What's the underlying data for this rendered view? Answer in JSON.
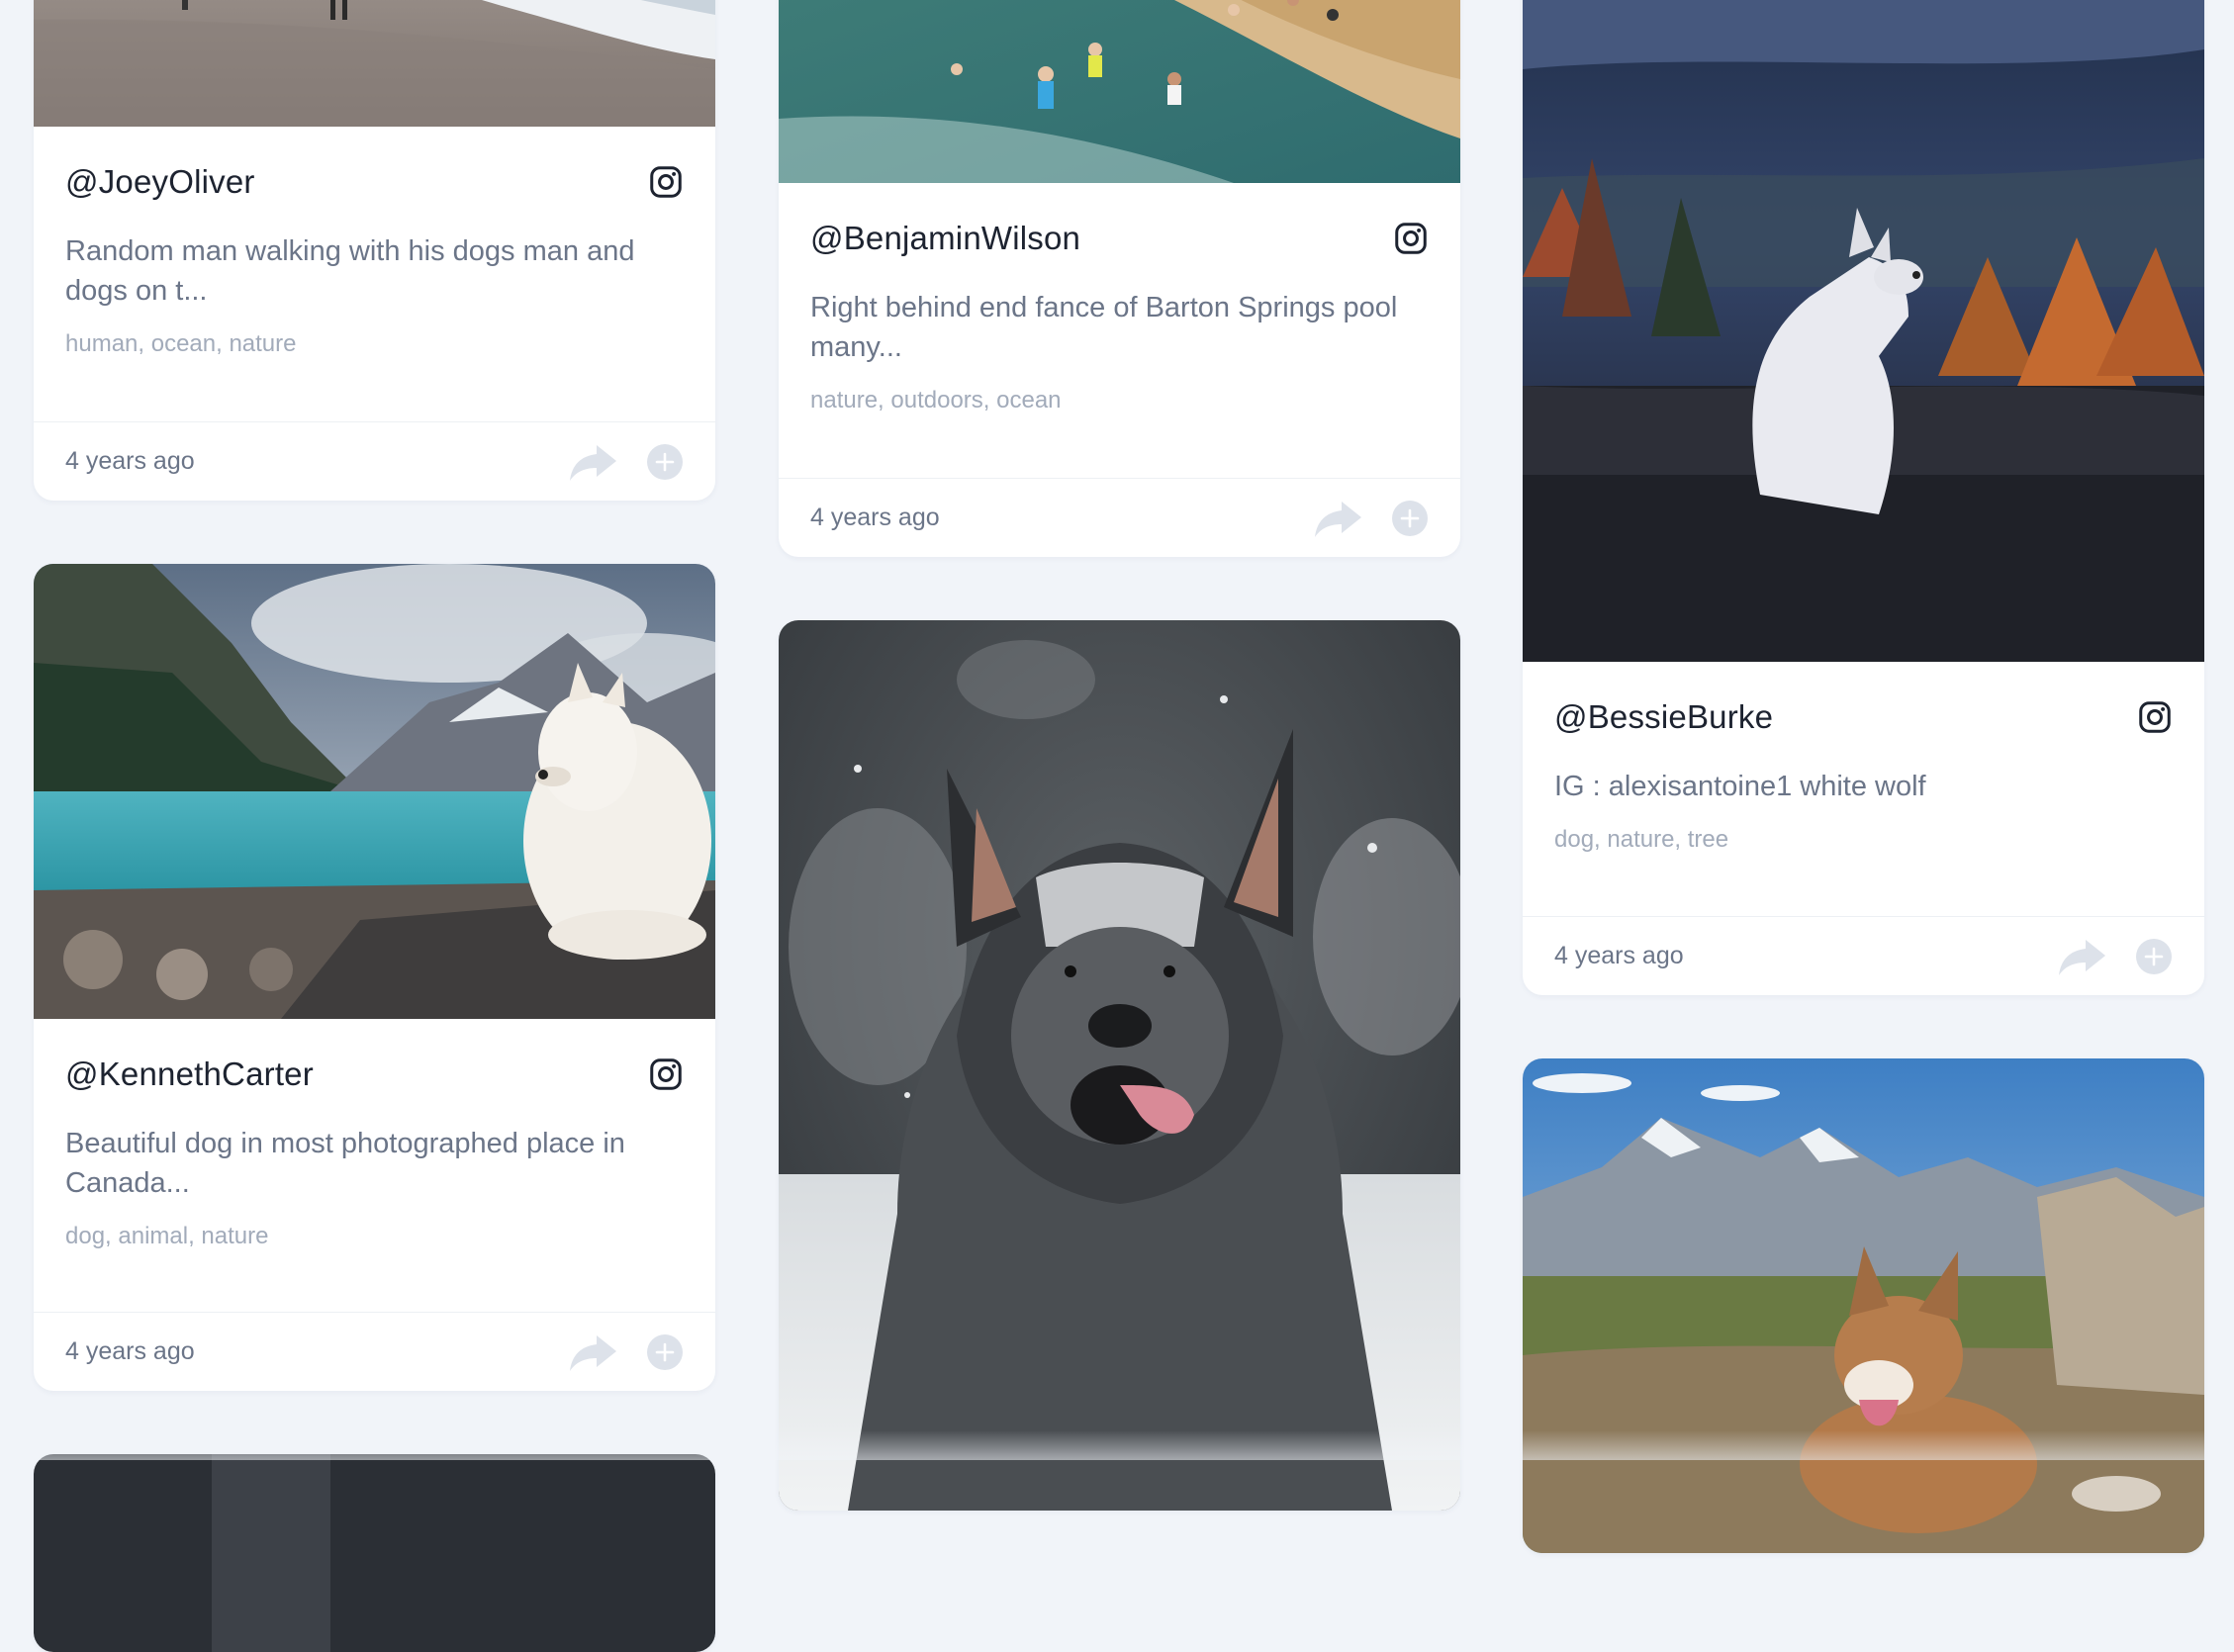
{
  "colors": {
    "background": "#f1f4f9",
    "card": "#ffffff",
    "handle_text": "#1d2330",
    "description_text": "#6b7588",
    "tags_text": "#a2abba",
    "action_icons": "#dde2ea"
  },
  "cards": {
    "joey": {
      "handle": "@JoeyOliver",
      "description": "Random man walking with his dogs man and dogs on t...",
      "tags": "human, ocean, nature",
      "time": "4 years ago",
      "source_icon": "instagram-icon"
    },
    "benjamin": {
      "handle": "@BenjaminWilson",
      "description": "Right behind end fance of Barton Springs pool many...",
      "tags": "nature, outdoors, ocean",
      "time": "4 years ago",
      "source_icon": "instagram-icon"
    },
    "bessie": {
      "handle": "@BessieBurke",
      "description": "IG : alexisantoine1 white wolf",
      "tags": "dog, nature, tree",
      "time": "4 years ago",
      "source_icon": "instagram-icon"
    },
    "kenneth": {
      "handle": "@KennethCarter",
      "description": "Beautiful dog in most photographed place in Canada...",
      "tags": "dog, animal, nature",
      "time": "4 years ago",
      "source_icon": "instagram-icon"
    }
  },
  "photos": {
    "beach": "photo-beach-dogs",
    "pool": "photo-barton-springs",
    "wolf": "photo-white-wolf",
    "lake": "photo-lake-louise-dog",
    "snow_dog": "photo-snow-dog",
    "mountain_dog": "photo-mountain-dog",
    "partial": "photo-partial"
  }
}
